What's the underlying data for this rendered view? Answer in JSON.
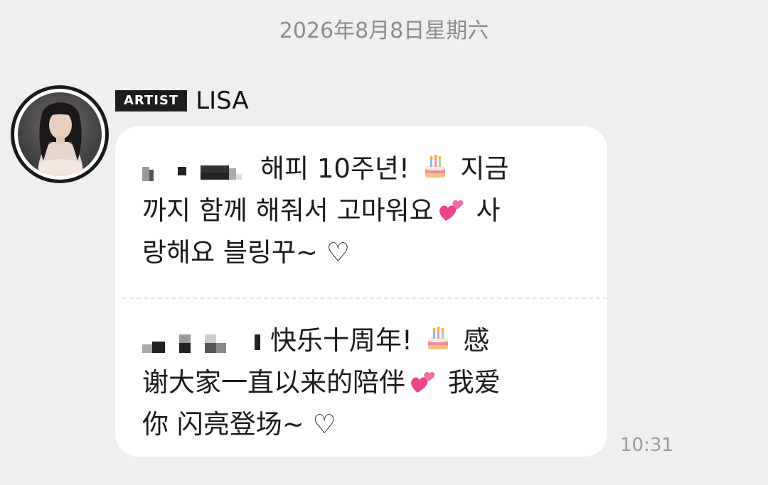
{
  "chat": {
    "date": "2026年8月8日星期六",
    "time": "10:31"
  },
  "sender": {
    "badge": "ARTIST",
    "name": "LISA"
  },
  "message_ko": {
    "part1": "해피 10주년!",
    "part2": "지금",
    "part3": "까지 함께 해줘서 고마워요",
    "part4": "사",
    "part5": "랑해요 블링꾸~ ♡"
  },
  "message_zh": {
    "part1": "快乐十周年!",
    "part2": "感",
    "part3": "谢大家一直以来的陪伴",
    "part4": "我爱",
    "part5": "你 闪亮登场~ ♡"
  },
  "icons": {
    "cake": "birthday-cake-emoji",
    "hearts": "two-hearts-emoji",
    "censor": "pixelated-redaction"
  },
  "colors": {
    "background": "#efefef",
    "bubble": "#ffffff",
    "badge": "#1d1d1d",
    "heart": "#e8458b"
  }
}
